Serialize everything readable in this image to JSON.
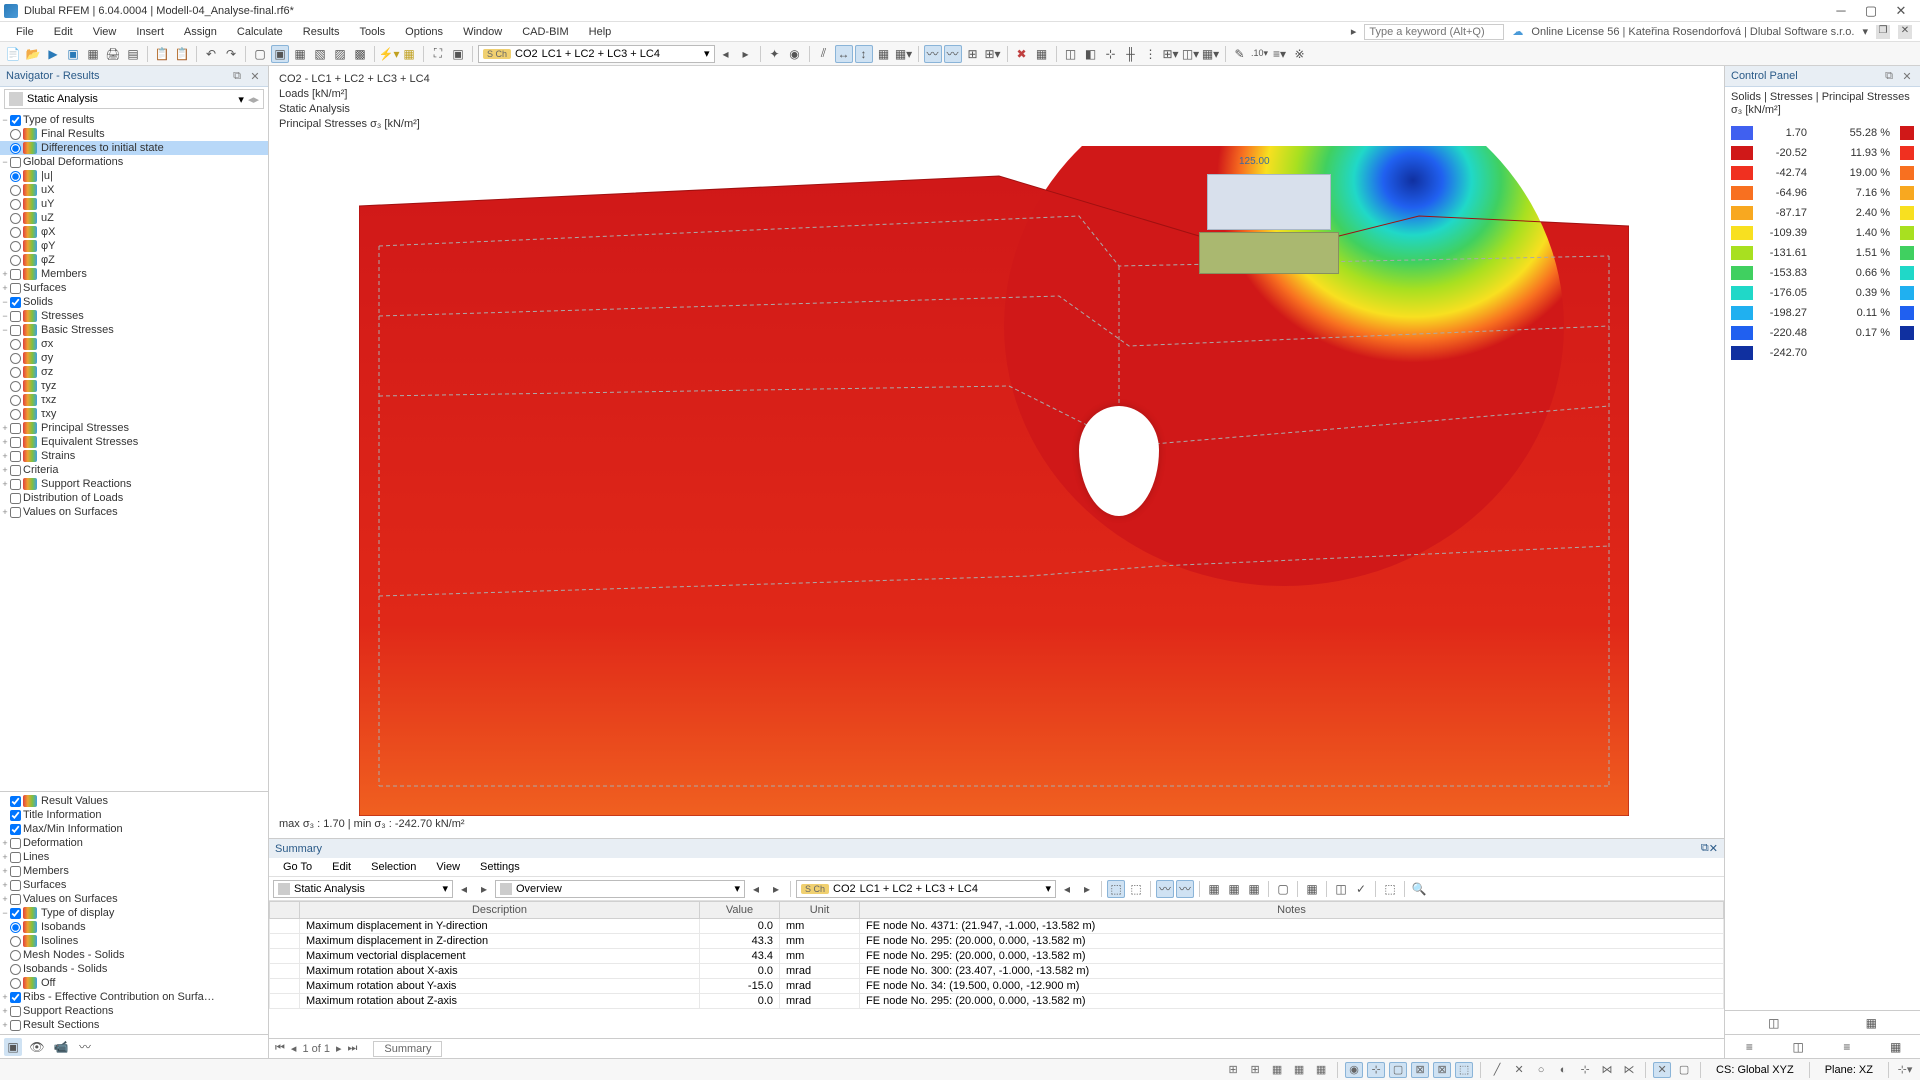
{
  "title": "Dlubal RFEM | 6.04.0004 | Modell-04_Analyse-final.rf6*",
  "menu": [
    "File",
    "Edit",
    "View",
    "Insert",
    "Assign",
    "Calculate",
    "Results",
    "Tools",
    "Options",
    "Window",
    "CAD-BIM",
    "Help"
  ],
  "search_placeholder": "Type a keyword (Alt+Q)",
  "license": "Online License 56 | Kateřina Rosendorfová | Dlubal Software s.r.o.",
  "combo": {
    "badge": "S Ch",
    "co": "CO2",
    "text": "LC1 + LC2 + LC3 + LC4"
  },
  "navigator": {
    "title": "Navigator - Results",
    "analysis": "Static Analysis",
    "tree1": [
      {
        "i": 0,
        "exp": "−",
        "chk": true,
        "lbl": "Type of results"
      },
      {
        "i": 1,
        "rad": false,
        "ico": "r",
        "lbl": "Final Results"
      },
      {
        "i": 1,
        "rad": true,
        "ico": "r",
        "lbl": "Differences to initial state",
        "sel": true
      },
      {
        "i": 0,
        "exp": "−",
        "chk": false,
        "lbl": "Global Deformations"
      },
      {
        "i": 1,
        "rad": true,
        "ico": "r",
        "lbl": "|u|"
      },
      {
        "i": 1,
        "rad": false,
        "ico": "r",
        "lbl": "uX"
      },
      {
        "i": 1,
        "rad": false,
        "ico": "r",
        "lbl": "uY"
      },
      {
        "i": 1,
        "rad": false,
        "ico": "r",
        "lbl": "uZ"
      },
      {
        "i": 1,
        "rad": false,
        "ico": "r",
        "lbl": "φX"
      },
      {
        "i": 1,
        "rad": false,
        "ico": "r",
        "lbl": "φY"
      },
      {
        "i": 1,
        "rad": false,
        "ico": "r",
        "lbl": "φZ"
      },
      {
        "i": 0,
        "exp": "+",
        "chk": false,
        "ico": "m",
        "lbl": "Members"
      },
      {
        "i": 0,
        "exp": "+",
        "chk": false,
        "lbl": "Surfaces"
      },
      {
        "i": 0,
        "exp": "−",
        "chk": true,
        "lbl": "Solids"
      },
      {
        "i": 1,
        "exp": "−",
        "chk": false,
        "ico": "s",
        "lbl": "Stresses"
      },
      {
        "i": 2,
        "exp": "−",
        "chk": false,
        "ico": "s",
        "lbl": "Basic Stresses"
      },
      {
        "i": 3,
        "rad": false,
        "ico": "s",
        "lbl": "σx"
      },
      {
        "i": 3,
        "rad": false,
        "ico": "s",
        "lbl": "σy"
      },
      {
        "i": 3,
        "rad": false,
        "ico": "s",
        "lbl": "σz"
      },
      {
        "i": 3,
        "rad": false,
        "ico": "s",
        "lbl": "τyz"
      },
      {
        "i": 3,
        "rad": false,
        "ico": "s",
        "lbl": "τxz"
      },
      {
        "i": 3,
        "rad": false,
        "ico": "s",
        "lbl": "τxy"
      },
      {
        "i": 2,
        "exp": "+",
        "chk": false,
        "ico": "s",
        "lbl": "Principal Stresses"
      },
      {
        "i": 2,
        "exp": "+",
        "chk": false,
        "ico": "s",
        "lbl": "Equivalent Stresses"
      },
      {
        "i": 1,
        "exp": "+",
        "chk": false,
        "ico": "s",
        "lbl": "Strains"
      },
      {
        "i": 0,
        "exp": "+",
        "chk": false,
        "lbl": "Criteria"
      },
      {
        "i": 0,
        "exp": "+",
        "chk": false,
        "ico": "sr",
        "lbl": "Support Reactions"
      },
      {
        "i": 0,
        "chk": false,
        "lbl": "Distribution of Loads"
      },
      {
        "i": 0,
        "exp": "+",
        "chk": false,
        "lbl": "Values on Surfaces"
      }
    ],
    "tree2": [
      {
        "i": 0,
        "chk": true,
        "ico": "rv",
        "lbl": "Result Values"
      },
      {
        "i": 0,
        "chk": true,
        "lbl": "Title Information"
      },
      {
        "i": 0,
        "chk": true,
        "lbl": "Max/Min Information"
      },
      {
        "i": 0,
        "exp": "+",
        "chk": false,
        "lbl": "Deformation"
      },
      {
        "i": 0,
        "exp": "+",
        "chk": false,
        "lbl": "Lines"
      },
      {
        "i": 0,
        "exp": "+",
        "chk": false,
        "lbl": "Members"
      },
      {
        "i": 0,
        "exp": "+",
        "chk": false,
        "lbl": "Surfaces"
      },
      {
        "i": 0,
        "exp": "+",
        "chk": false,
        "lbl": "Values on Surfaces"
      },
      {
        "i": 0,
        "exp": "−",
        "chk": true,
        "ico": "td",
        "lbl": "Type of display"
      },
      {
        "i": 1,
        "rad": true,
        "ico": "ib",
        "lbl": "Isobands"
      },
      {
        "i": 1,
        "rad": false,
        "ico": "il",
        "lbl": "Isolines"
      },
      {
        "i": 1,
        "rad": false,
        "lbl": "Mesh Nodes - Solids"
      },
      {
        "i": 1,
        "rad": false,
        "lbl": "Isobands - Solids"
      },
      {
        "i": 1,
        "rad": false,
        "ico": "x",
        "lbl": "Off"
      },
      {
        "i": 0,
        "exp": "+",
        "chk": true,
        "lbl": "Ribs - Effective Contribution on Surfa…"
      },
      {
        "i": 0,
        "exp": "+",
        "chk": false,
        "lbl": "Support Reactions"
      },
      {
        "i": 0,
        "exp": "+",
        "chk": false,
        "lbl": "Result Sections"
      }
    ]
  },
  "viewport": {
    "lines": [
      "CO2 - LC1 + LC2 + LC3 + LC4",
      "Loads [kN/m²]",
      "Static Analysis",
      "Principal Stresses σ₃ [kN/m²]"
    ],
    "load_label": "125.00",
    "minmax": "max σ₃ : 1.70 | min σ₃ : -242.70 kN/m²"
  },
  "summary": {
    "title": "Summary",
    "menu": [
      "Go To",
      "Edit",
      "Selection",
      "View",
      "Settings"
    ],
    "analysis": "Static Analysis",
    "overview": "Overview",
    "badge": "S Ch",
    "co": "CO2",
    "combo": "LC1 + LC2 + LC3 + LC4",
    "cols": [
      "Description",
      "Value",
      "Unit",
      "Notes"
    ],
    "rows": [
      [
        "Maximum displacement in Y-direction",
        "0.0",
        "mm",
        "FE node No. 4371: (21.947, -1.000, -13.582 m)"
      ],
      [
        "Maximum displacement in Z-direction",
        "43.3",
        "mm",
        "FE node No. 295: (20.000, 0.000, -13.582 m)"
      ],
      [
        "Maximum vectorial displacement",
        "43.4",
        "mm",
        "FE node No. 295: (20.000, 0.000, -13.582 m)"
      ],
      [
        "Maximum rotation about X-axis",
        "0.0",
        "mrad",
        "FE node No. 300: (23.407, -1.000, -13.582 m)"
      ],
      [
        "Maximum rotation about Y-axis",
        "-15.0",
        "mrad",
        "FE node No. 34: (19.500, 0.000, -12.900 m)"
      ],
      [
        "Maximum rotation about Z-axis",
        "0.0",
        "mrad",
        "FE node No. 295: (20.000, 0.000, -13.582 m)"
      ]
    ],
    "pager": "1 of 1",
    "tab": "Summary"
  },
  "cpanel": {
    "title": "Control Panel",
    "subtitle": "Solids | Stresses | Principal Stresses σ₃ [kN/m²]",
    "left": [
      {
        "c": "#4060f0",
        "v": "1.70"
      },
      {
        "c": "#d01818",
        "v": "-20.52"
      },
      {
        "c": "#f03020",
        "v": "-42.74"
      },
      {
        "c": "#f87020",
        "v": "-64.96"
      },
      {
        "c": "#f8a820",
        "v": "-87.17"
      },
      {
        "c": "#f8e020",
        "v": "-109.39"
      },
      {
        "c": "#a8e020",
        "v": "-131.61"
      },
      {
        "c": "#40d060",
        "v": "-153.83"
      },
      {
        "c": "#20d8c8",
        "v": "-176.05"
      },
      {
        "c": "#20b0f0",
        "v": "-198.27"
      },
      {
        "c": "#2060f0",
        "v": "-220.48"
      },
      {
        "c": "#1030a0",
        "v": "-242.70"
      }
    ],
    "right": [
      {
        "c": "#d01818",
        "v": "55.28 %"
      },
      {
        "c": "#f03020",
        "v": "11.93 %"
      },
      {
        "c": "#f87020",
        "v": "19.00 %"
      },
      {
        "c": "#f8a820",
        "v": "7.16 %"
      },
      {
        "c": "#f8e020",
        "v": "2.40 %"
      },
      {
        "c": "#a8e020",
        "v": "1.40 %"
      },
      {
        "c": "#40d060",
        "v": "1.51 %"
      },
      {
        "c": "#20d8c8",
        "v": "0.66 %"
      },
      {
        "c": "#20b0f0",
        "v": "0.39 %"
      },
      {
        "c": "#2060f0",
        "v": "0.11 %"
      },
      {
        "c": "#1030a0",
        "v": "0.17 %"
      }
    ]
  },
  "status": {
    "cs": "CS: Global XYZ",
    "plane": "Plane: XZ"
  },
  "chart_data": {
    "type": "colorscale",
    "title": "Principal Stresses σ₃ [kN/m²]",
    "values": [
      1.7,
      -20.52,
      -42.74,
      -64.96,
      -87.17,
      -109.39,
      -131.61,
      -153.83,
      -176.05,
      -198.27,
      -220.48,
      -242.7
    ],
    "percent": [
      55.28,
      11.93,
      19.0,
      7.16,
      2.4,
      1.4,
      1.51,
      0.66,
      0.39,
      0.11,
      0.17
    ],
    "ylim": [
      -242.7,
      1.7
    ]
  }
}
